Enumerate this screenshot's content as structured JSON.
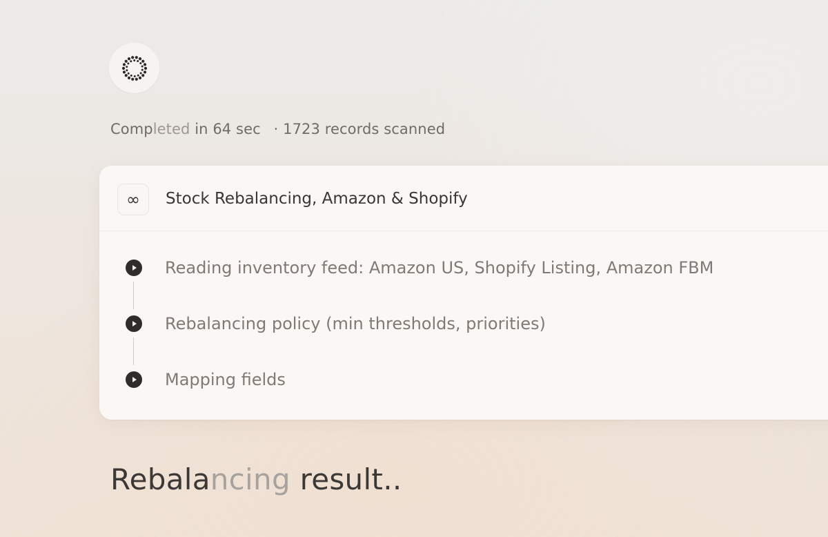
{
  "agent": {
    "icon": "dotted-ring-icon"
  },
  "status": {
    "completed_prefix": "Comp",
    "completed_mid": "leted",
    "completed_suffix": " in 64 sec",
    "separator": "·",
    "records": "1723 records scanned"
  },
  "workflow": {
    "icon": "infinity-icon",
    "icon_glyph": "∞",
    "title": "Stock Rebalancing, Amazon & Shopify",
    "steps": [
      {
        "label": "Reading inventory feed: Amazon US, Shopify Listing, Amazon FBM",
        "icon": "play-icon"
      },
      {
        "label": "Rebalancing policy (min thresholds, priorities)",
        "icon": "play-icon"
      },
      {
        "label": "Mapping fields",
        "icon": "play-icon"
      }
    ]
  },
  "result": {
    "heading_start": "Rebala",
    "heading_fade": "ncing",
    "heading_end": " result.."
  }
}
